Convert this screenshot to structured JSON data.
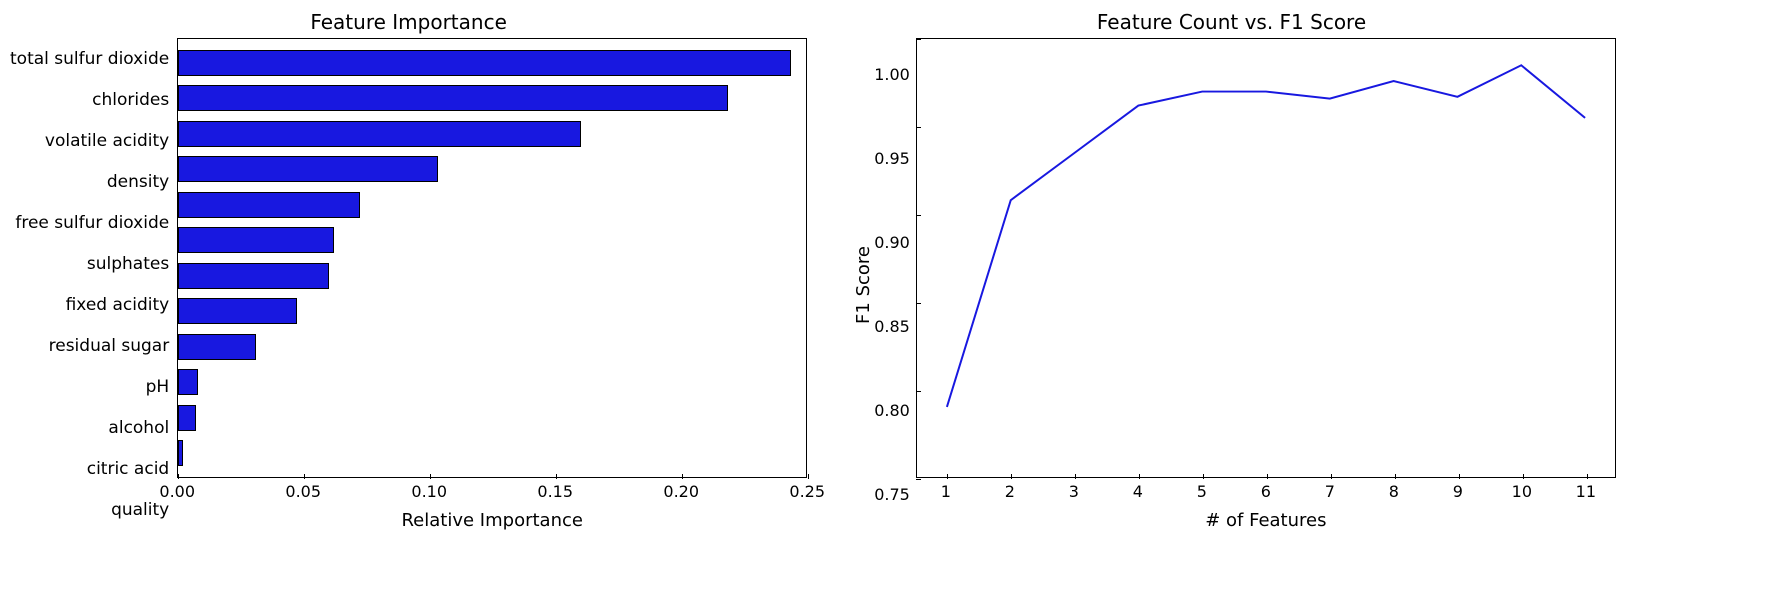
{
  "chart_data": [
    {
      "type": "bar",
      "orientation": "horizontal",
      "title": "Feature Importance",
      "xlabel": "Relative Importance",
      "ylabel": "",
      "xlim": [
        0.0,
        0.25
      ],
      "xticks": [
        0.0,
        0.05,
        0.1,
        0.15,
        0.2,
        0.25
      ],
      "categories": [
        "total sulfur dioxide",
        "chlorides",
        "volatile acidity",
        "density",
        "free sulfur dioxide",
        "sulphates",
        "fixed acidity",
        "residual sugar",
        "pH",
        "alcohol",
        "citric acid",
        "quality"
      ],
      "values": [
        0.243,
        0.218,
        0.16,
        0.103,
        0.072,
        0.062,
        0.06,
        0.047,
        0.031,
        0.008,
        0.007,
        0.002
      ],
      "bar_color": "#1818e0"
    },
    {
      "type": "line",
      "title": "Feature Count vs. F1 Score",
      "xlabel": "# of Features",
      "ylabel": "F1 Score",
      "xlim": [
        1,
        11
      ],
      "ylim": [
        0.75,
        1.0
      ],
      "xticks": [
        1,
        2,
        3,
        4,
        5,
        6,
        7,
        8,
        9,
        10,
        11
      ],
      "yticks": [
        0.75,
        0.8,
        0.85,
        0.9,
        0.95,
        1.0
      ],
      "x": [
        1,
        2,
        3,
        4,
        5,
        6,
        7,
        8,
        9,
        10,
        11
      ],
      "y": [
        0.79,
        0.908,
        0.935,
        0.962,
        0.97,
        0.97,
        0.966,
        0.976,
        0.967,
        0.985,
        0.955
      ],
      "line_color": "#1818e0"
    }
  ]
}
